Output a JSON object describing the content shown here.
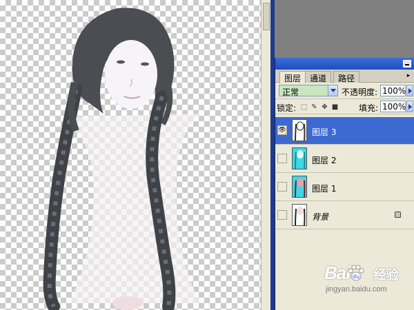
{
  "panel": {
    "tabs": [
      {
        "label": "图层",
        "active": true
      },
      {
        "label": "通道",
        "active": false
      },
      {
        "label": "路径",
        "active": false
      }
    ],
    "blend_mode": "正常",
    "opacity_label": "不透明度:",
    "opacity_value": "100%",
    "lock_label": "锁定:",
    "fill_label": "填充:",
    "fill_value": "100%"
  },
  "layers": [
    {
      "name": "图层 3",
      "visible": true,
      "selected": true,
      "thumb": "portrait-sketch"
    },
    {
      "name": "图层 2",
      "visible": false,
      "selected": false,
      "thumb": "portrait-cyan"
    },
    {
      "name": "图层 1",
      "visible": false,
      "selected": false,
      "thumb": "portrait-cyan"
    },
    {
      "name": "背景",
      "visible": false,
      "selected": false,
      "thumb": "portrait-original",
      "locked": true
    }
  ],
  "watermark": {
    "logo": "Bai",
    "logo_suffix": "经验",
    "url": "jingyan.baidu.com"
  },
  "colors": {
    "selected_layer": "#3d6ad0",
    "panel_bg": "#ece9d8",
    "blend_field": "#c8e6c0",
    "thumb_cyan": "#3ed7e6"
  }
}
